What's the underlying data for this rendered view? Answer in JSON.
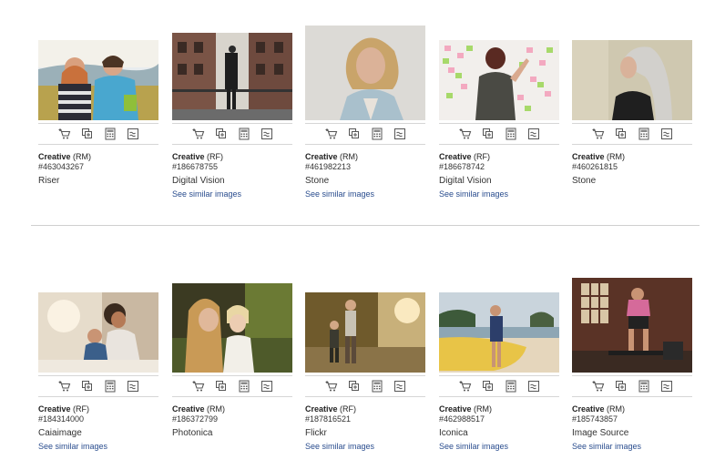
{
  "action_icons": [
    "add-to-cart-icon",
    "add-to-lightbox-icon",
    "calculate-price-icon",
    "similar-icon"
  ],
  "row1": [
    {
      "license_type": "Creative",
      "license_code": "(RM)",
      "image_id": "#463043267",
      "collection": "Riser",
      "similar_link": ""
    },
    {
      "license_type": "Creative",
      "license_code": "(RF)",
      "image_id": "#186678755",
      "collection": "Digital Vision",
      "similar_link": "See similar images"
    },
    {
      "license_type": "Creative",
      "license_code": "(RM)",
      "image_id": "#461982213",
      "collection": "Stone",
      "similar_link": "See similar images"
    },
    {
      "license_type": "Creative",
      "license_code": "(RF)",
      "image_id": "#186678742",
      "collection": "Digital Vision",
      "similar_link": "See similar images"
    },
    {
      "license_type": "Creative",
      "license_code": "(RM)",
      "image_id": "#460261815",
      "collection": "Stone",
      "similar_link": ""
    }
  ],
  "row2": [
    {
      "license_type": "Creative",
      "license_code": "(RF)",
      "image_id": "#184314000",
      "collection": "Caiaimage",
      "similar_link": "See similar images"
    },
    {
      "license_type": "Creative",
      "license_code": "(RM)",
      "image_id": "#186372799",
      "collection": "Photonica",
      "similar_link": ""
    },
    {
      "license_type": "Creative",
      "license_code": "(RF)",
      "image_id": "#187816521",
      "collection": "Flickr",
      "similar_link": "See similar images"
    },
    {
      "license_type": "Creative",
      "license_code": "(RM)",
      "image_id": "#462988517",
      "collection": "Iconica",
      "similar_link": "See similar images"
    },
    {
      "license_type": "Creative",
      "license_code": "(RM)",
      "image_id": "#185743857",
      "collection": "Image Source",
      "similar_link": "See similar images"
    }
  ]
}
